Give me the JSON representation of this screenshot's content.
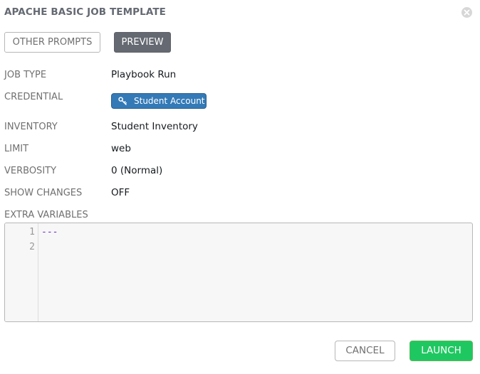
{
  "modal": {
    "title": "APACHE BASIC JOB TEMPLATE"
  },
  "steps": {
    "other_prompts": "OTHER PROMPTS",
    "preview": "PREVIEW"
  },
  "fields": {
    "job_type": {
      "label": "JOB TYPE",
      "value": "Playbook Run"
    },
    "credential": {
      "label": "CREDENTIAL",
      "value": "Student Account",
      "icon": "key-icon"
    },
    "inventory": {
      "label": "INVENTORY",
      "value": "Student Inventory"
    },
    "limit": {
      "label": "LIMIT",
      "value": "web"
    },
    "verbosity": {
      "label": "VERBOSITY",
      "value": "0 (Normal)"
    },
    "show_changes": {
      "label": "SHOW CHANGES",
      "value": "OFF"
    }
  },
  "extra_variables": {
    "label": "EXTRA VARIABLES",
    "lines": [
      {
        "number": "1",
        "text": "---"
      },
      {
        "number": "2",
        "text": ""
      }
    ]
  },
  "actions": {
    "cancel": "CANCEL",
    "launch": "LAUNCH"
  },
  "colors": {
    "credential_tag": "#337ab7",
    "launch_button": "#1fc761",
    "preview_button": "#646972",
    "yaml_marker": "#6b2fc7"
  }
}
